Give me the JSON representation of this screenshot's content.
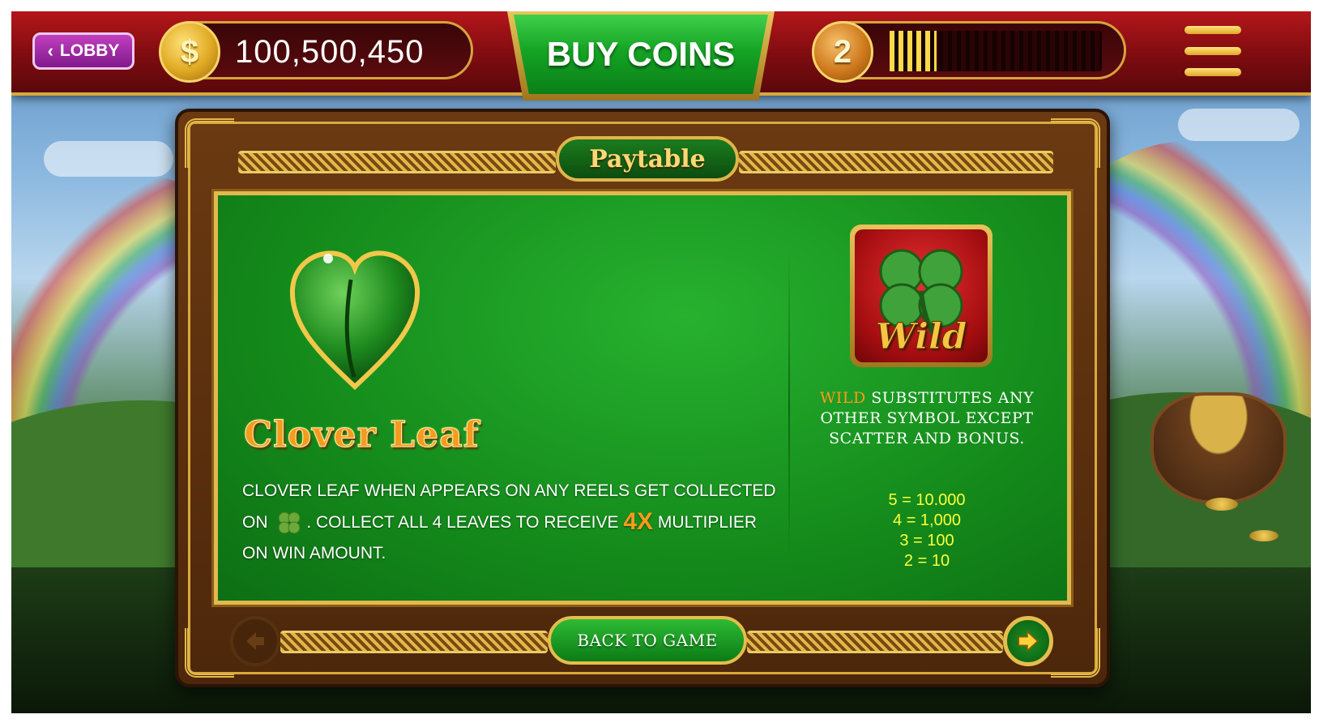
{
  "topbar": {
    "lobby_label": "LOBBY",
    "coin_symbol": "$",
    "balance": "100,500,450",
    "buy_coins_label": "BUY COINS",
    "level": "2",
    "xp_progress": 0.22
  },
  "paytable": {
    "title": "Paytable",
    "symbol_name": "Clover Leaf",
    "description": {
      "line1": "Clover leaf when appears on any reels get collected",
      "line2_prefix": "on",
      "line2_mid": ". collect all 4 leaves to receive",
      "multiplier": "4x",
      "line2_suffix": "multiplier",
      "line3": "on win amount."
    },
    "wild": {
      "icon_label": "Wild",
      "word": "WILD",
      "text": "SUBSTITUTES ANY OTHER SYMBOL EXCEPT SCATTER AND BONUS.",
      "payouts": [
        "5 = 10.000",
        "4 =  1,000",
        "3 = 100",
        "2 = 10"
      ]
    },
    "back_label": "BACK TO GAME"
  },
  "icons": {
    "lobby_chevron": "chevron-left-icon",
    "coin": "dollar-coin-icon",
    "menu": "hamburger-menu-icon",
    "prev": "arrow-left-icon",
    "next": "arrow-right-icon"
  },
  "colors": {
    "topbar_red": "#7e0c10",
    "gold": "#d9a93c",
    "felt_green": "#148a1b",
    "highlight_orange": "#ff9a1c",
    "payout_yellow": "#ffff3a"
  }
}
